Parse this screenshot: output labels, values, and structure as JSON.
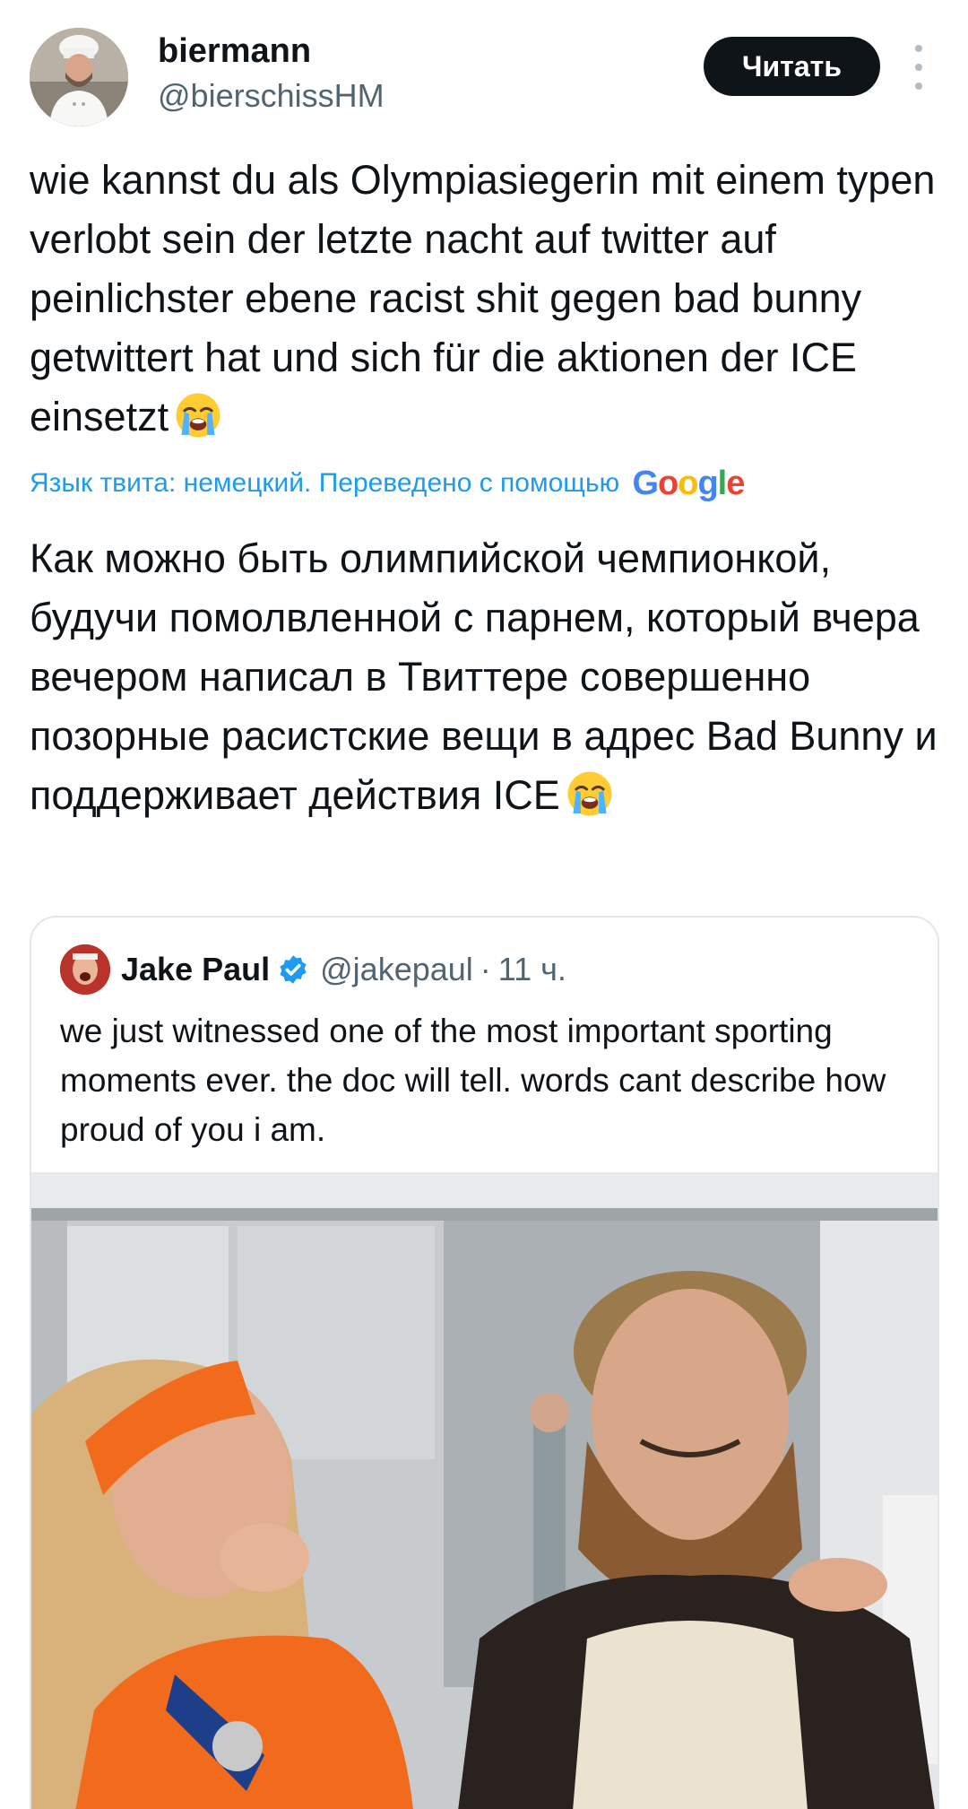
{
  "author": {
    "name": "biermann",
    "handle": "@bierschissHM",
    "avatar_icon": "chef-avatar"
  },
  "actions": {
    "follow_label": "Читать",
    "more_icon": "more-vertical-icon"
  },
  "tweet": {
    "text": "wie kannst du als Olympiasiegerin mit einem typen verlobt sein der letzte nacht auf twitter auf peinlichster ebene racist shit gegen bad bunny getwittert hat und sich für die aktionen der ICE einsetzt",
    "emoji": "loudly-crying-face-emoji",
    "translation_note": "Язык твита: немецкий. Переведено с помощью",
    "translation_provider": "Google",
    "translated_text": "Как можно быть олимпийской чемпионкой, будучи помолвленной с парнем, который вчера вечером написал в Твиттере совершенно позорные расистские вещи в адрес Bad Bunny и поддерживает действия ICE"
  },
  "quoted_tweet": {
    "name": "Jake Paul",
    "verified_icon": "verified-badge-icon",
    "handle": "@jakepaul",
    "separator": "·",
    "time": "11 ч.",
    "text": "we just witnessed one of the most important sporting moments ever. the doc will tell. words cant describe how proud of you i am.",
    "photo_icon": "tweet-photo"
  },
  "colors": {
    "text": "#0f1419",
    "secondary": "#536471",
    "link": "#1d9bf0",
    "button_bg": "#0f1419",
    "border": "#e1e8ed",
    "orange": "#f26a1b"
  }
}
